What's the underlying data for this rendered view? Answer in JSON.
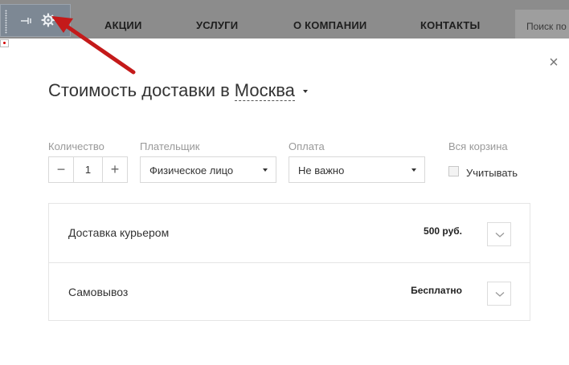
{
  "nav": {
    "items": [
      "АКЦИИ",
      "УСЛУГИ",
      "О КОМПАНИИ",
      "КОНТАКТЫ"
    ],
    "search_placeholder": "Поиск по"
  },
  "admin_panel": {
    "icons": [
      "drag-handle",
      "pin-icon",
      "gear-icon",
      "chevron-down-icon"
    ]
  },
  "modal": {
    "title": "Стоимость доставки в",
    "city": "Москва",
    "close_label": "×",
    "fields": {
      "quantity_label": "Количество",
      "quantity_value": "1",
      "minus_label": "−",
      "plus_label": "+",
      "payer_label": "Плательщик",
      "payer_value": "Физическое лицо",
      "payment_label": "Оплата",
      "payment_value": "Не важно",
      "cart_label": "Вся корзина",
      "cart_checkbox_label": "Учитывать"
    },
    "delivery_options": [
      {
        "name": "Доставка курьером",
        "price": "500 руб."
      },
      {
        "name": "Самовывоз",
        "price": "Бесплатно"
      }
    ]
  },
  "colors": {
    "overlay": "#8c8c8c",
    "admin_panel": "#7d8894",
    "arrow": "#c41a1a"
  }
}
